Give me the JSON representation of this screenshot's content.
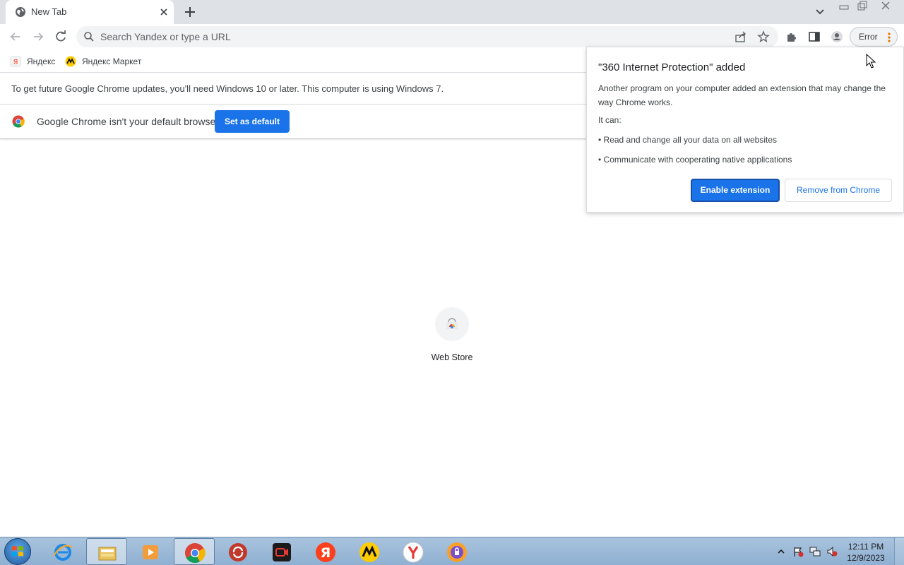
{
  "tab": {
    "title": "New Tab"
  },
  "omnibox": {
    "placeholder": "Search Yandex or type a URL"
  },
  "profile": {
    "error_label": "Error"
  },
  "bookmarks": [
    {
      "label": "Яндекс"
    },
    {
      "label": "Яндекс Маркет"
    }
  ],
  "infobar_update": {
    "text": "To get future Google Chrome updates, you'll need Windows 10 or later. This computer is using Windows 7."
  },
  "infobar_default": {
    "text": "Google Chrome isn't your default browser",
    "button": "Set as default"
  },
  "shortcut": {
    "label": "Web Store"
  },
  "extension_popup": {
    "title": "\"360 Internet Protection\" added",
    "description": "Another program on your computer added an extension that may change the way Chrome works.",
    "can_label": "It can:",
    "bullets": [
      "• Read and change all your data on all websites",
      "• Communicate with cooperating native applications"
    ],
    "enable_button": "Enable extension",
    "remove_button": "Remove from Chrome"
  },
  "taskbar": {
    "apps": [
      "internet-explorer",
      "file-explorer",
      "media-player",
      "chrome",
      "app-red-arrows",
      "screen-recorder",
      "yandex",
      "yandex-market",
      "yandex-browser",
      "vpn-shield"
    ],
    "clock_time": "12:11 PM",
    "clock_date": "12/9/2023"
  },
  "colors": {
    "accent": "#1a73e8",
    "tabstrip": "#dee1e6",
    "taskbar": "#9db9d8"
  }
}
